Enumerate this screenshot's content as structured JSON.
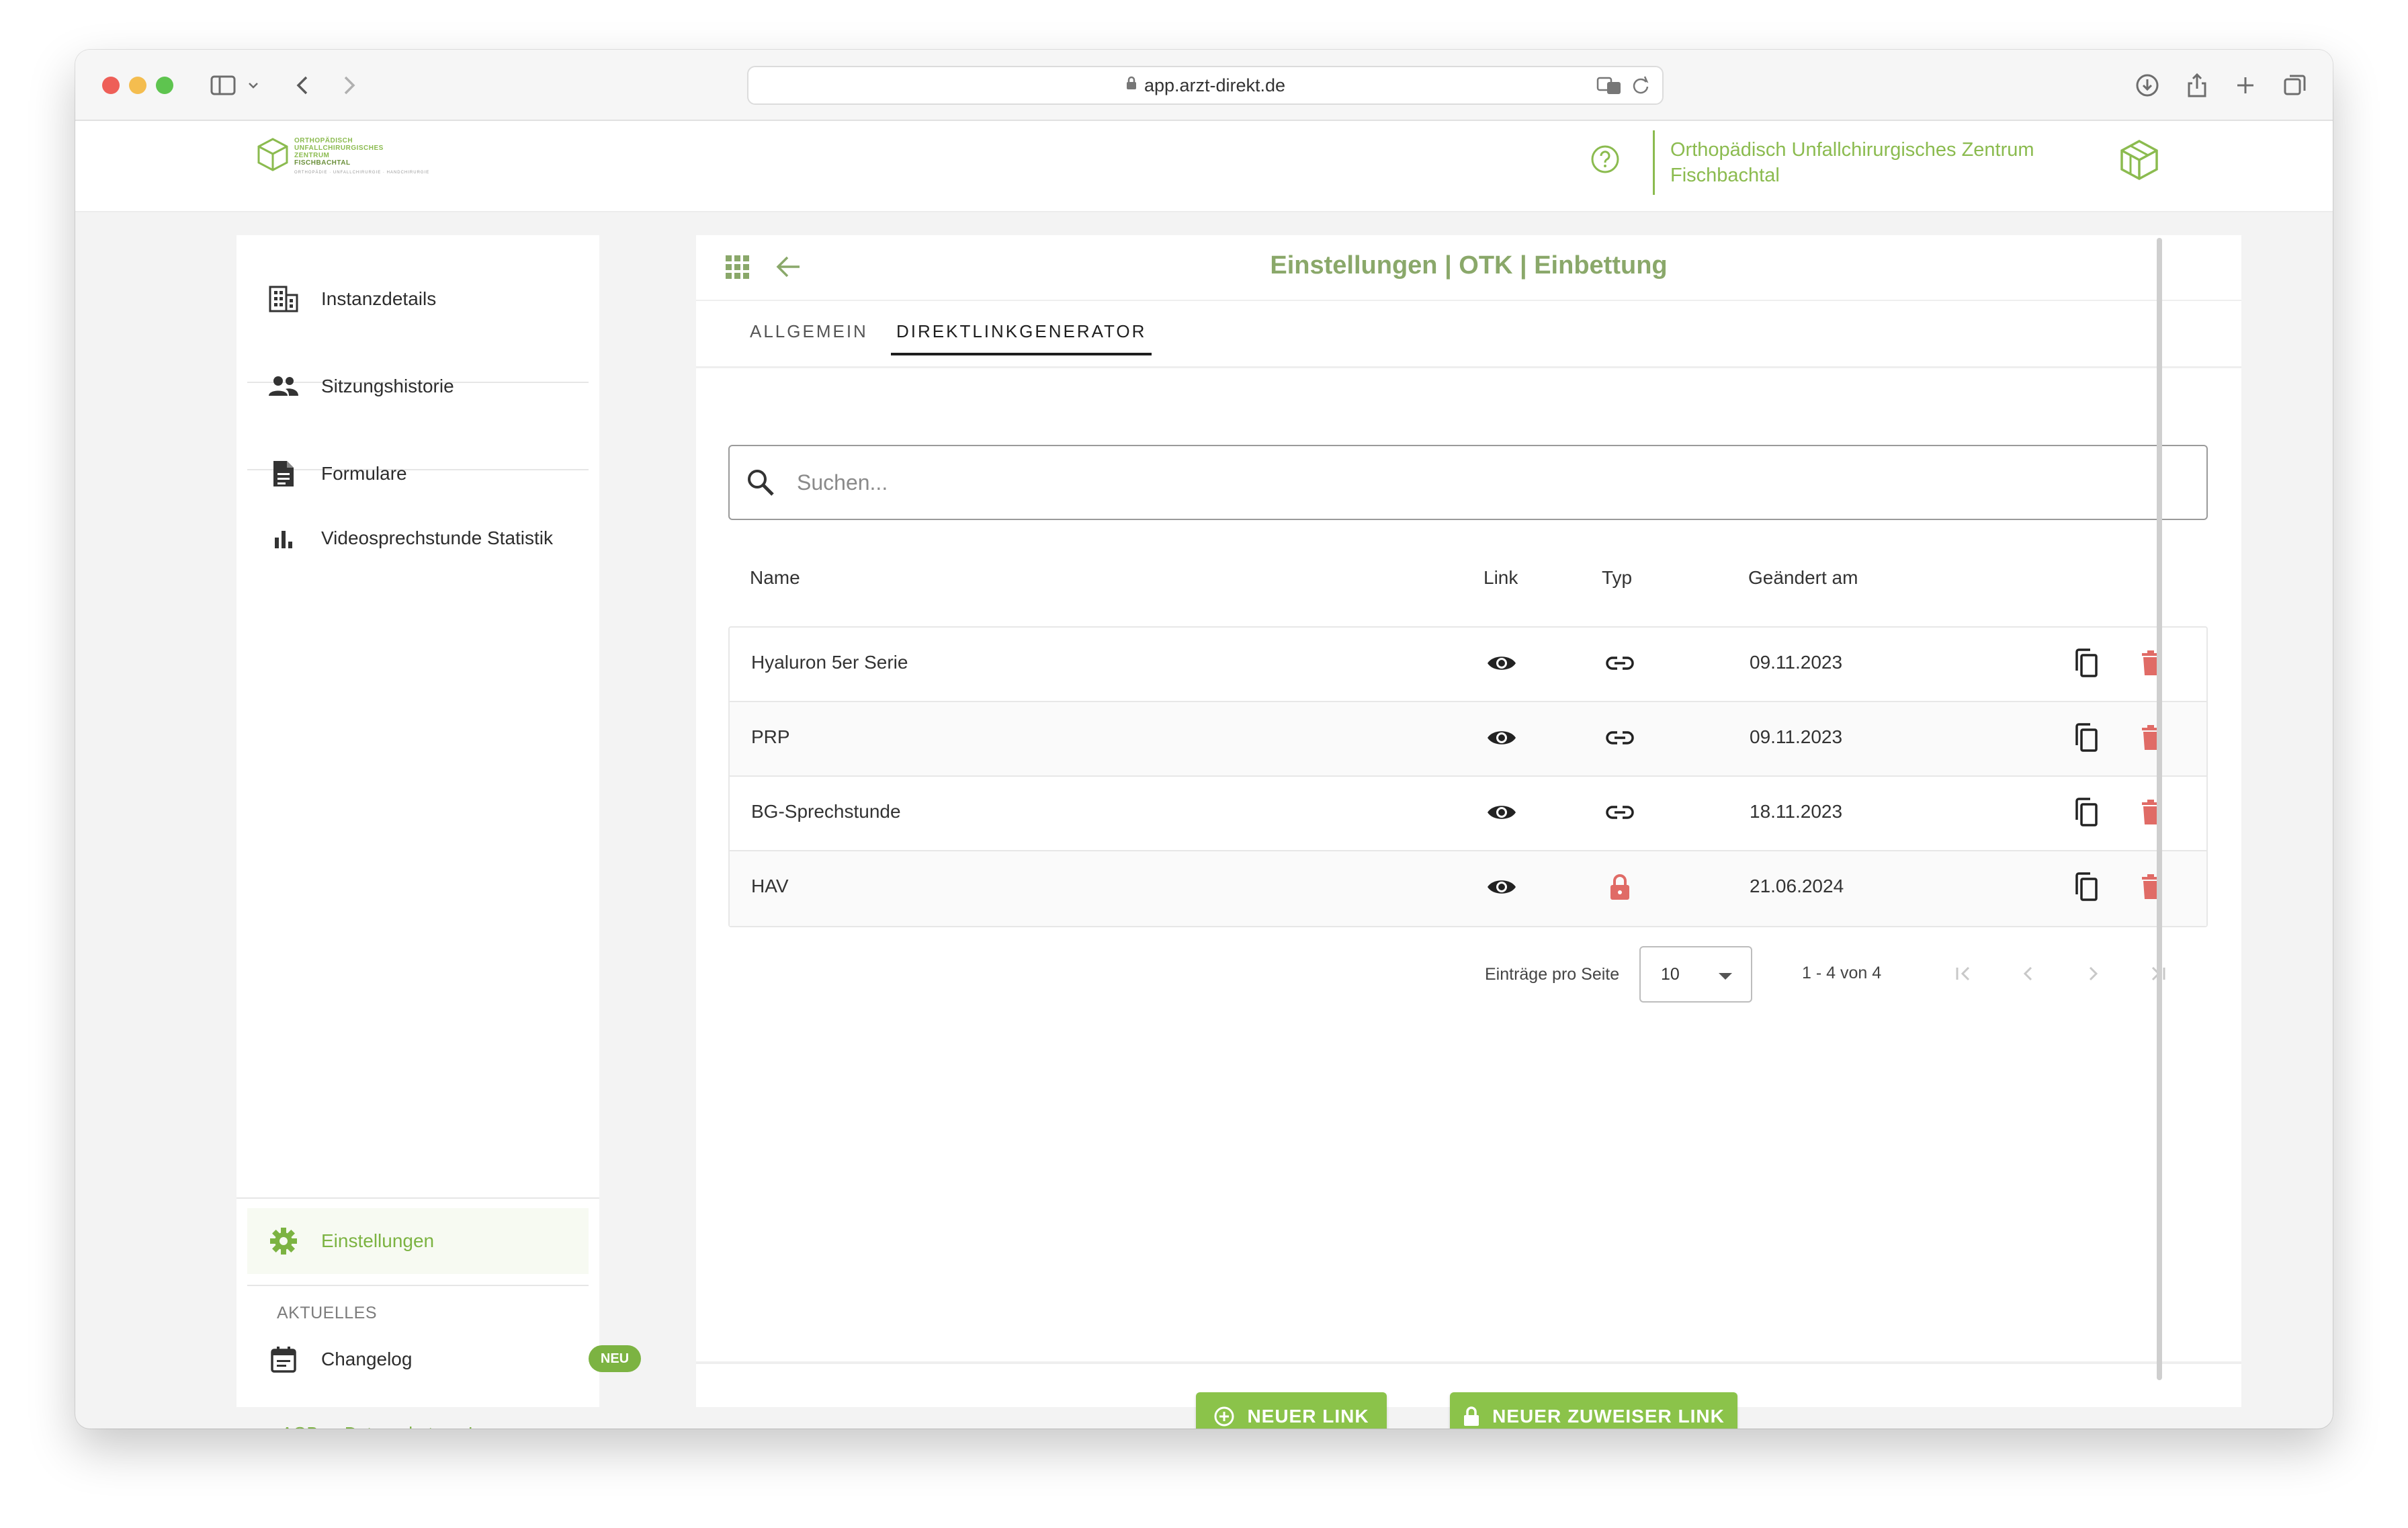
{
  "browser": {
    "url": "app.arzt-direkt.de"
  },
  "header": {
    "logo_text_lines": [
      "ORTHOPÄDISCH",
      "UNFALLCHIRURGISCHES",
      "ZENTRUM",
      "FISCHBACHTAL"
    ],
    "logo_subline": "ORTHOPÄDIE · UNFALLCHIRURGIE · HANDCHIRURGIE",
    "org_name_line1": "Orthopädisch Unfallchirurgisches Zentrum",
    "org_name_line2": "Fischbachtal",
    "help_icon": "help-circle-icon",
    "accent_color": "#8bbb4f"
  },
  "sidebar": {
    "items": [
      {
        "label": "Instanzdetails",
        "icon": "building-icon"
      },
      {
        "label": "Sitzungshistorie",
        "icon": "people-icon"
      },
      {
        "label": "Formulare",
        "icon": "document-icon"
      },
      {
        "label": "Videosprechstunde Statistik",
        "icon": "bar-chart-icon"
      }
    ],
    "settings": {
      "label": "Einstellungen",
      "icon": "gear-icon"
    },
    "section_label": "AKTUELLES",
    "changelog": {
      "label": "Changelog",
      "icon": "calendar-icon",
      "badge": "NEU"
    },
    "footer_links": [
      "AGB",
      "Datenschutz",
      "Impressum"
    ]
  },
  "main": {
    "title": "Einstellungen | OTK | Einbettung",
    "tabs": [
      {
        "label": "ALLGEMEIN",
        "active": false
      },
      {
        "label": "DIREKTLINKGENERATOR",
        "active": true
      }
    ],
    "search": {
      "placeholder": "Suchen...",
      "value": ""
    },
    "table": {
      "columns": [
        "Name",
        "Link",
        "Typ",
        "Geändert am"
      ],
      "rows": [
        {
          "name": "Hyaluron 5er Serie",
          "link_icon": "eye-icon",
          "type_icon": "link-icon",
          "date": "09.11.2023"
        },
        {
          "name": "PRP",
          "link_icon": "eye-icon",
          "type_icon": "link-icon",
          "date": "09.11.2023"
        },
        {
          "name": "BG-Sprechstunde",
          "link_icon": "eye-icon",
          "type_icon": "link-icon",
          "date": "18.11.2023"
        },
        {
          "name": "HAV",
          "link_icon": "eye-icon",
          "type_icon": "lock-icon",
          "date": "21.06.2024"
        }
      ]
    },
    "pagination": {
      "per_page_label": "Einträge pro Seite",
      "per_page_value": "10",
      "range": "1 - 4 von 4"
    },
    "buttons": {
      "new_link": "NEUER LINK",
      "new_referrer_link": "NEUER ZUWEISER LINK"
    },
    "colors": {
      "delete": "#e06b66",
      "button": "#8bc34a",
      "title": "#8aa86a"
    }
  }
}
